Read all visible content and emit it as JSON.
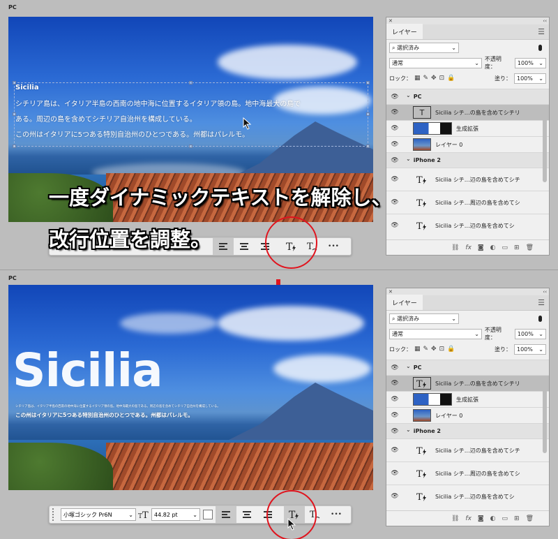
{
  "top": {
    "section_label": "PC",
    "text_title": "Sicilia",
    "text_lines": [
      "シチリア島は、イタリア半島の西南の地中海に位置するイタリア領の島。地中海最大の島で",
      "ある。周辺の島を含めてシチリア自治州を構成している。",
      "この州はイタリアに5つある特別自治州のひとつである。州都はパレルモ。"
    ],
    "caption_line1": "一度ダイナミックテキストを解除し、",
    "caption_line2": "改行位置を調整。",
    "toolbar": {
      "more_label": "•••"
    }
  },
  "bottom": {
    "section_label": "PC",
    "text_title": "Sicilia",
    "small_lines": [
      "シチリア島は、イタリア半島の西南の地中海に位置するイタリア領の島。地中海最大の島である。周辺の島を含めてシチリア自治州を構成している。",
      "この州はイタリアに5つある特別自治州のひとつである。州都はパレルモ。"
    ],
    "toolbar": {
      "font_family": "小塚ゴシック Pr6N",
      "font_size": "44.82 pt",
      "more_label": "•••"
    }
  },
  "panel": {
    "tab_label": "レイヤー",
    "filter_placeholder": "選択済み",
    "blend_mode": "通常",
    "opacity_label": "不透明度：",
    "opacity_value": "100%",
    "lock_label": "ロック：",
    "fill_label": "塗り：",
    "fill_value": "100%",
    "layers": [
      {
        "name": "PC",
        "kind": "group"
      },
      {
        "name": "Sicilia シチ…の島を含めてシチリ",
        "kind": "text",
        "selected": true
      },
      {
        "name": "生成拡張",
        "kind": "adjust"
      },
      {
        "name": "レイヤー 0",
        "kind": "image"
      },
      {
        "name": "iPhone 2",
        "kind": "group"
      },
      {
        "name": "Sicilia シチ…辺の島を含めてシチ",
        "kind": "text"
      },
      {
        "name": "Sicilia シチ…周辺の島を含めてシ",
        "kind": "text"
      },
      {
        "name": "Sicilia シチ…辺の島を含めてシ",
        "kind": "text"
      }
    ]
  },
  "colors": {
    "accent_red": "#e0141e",
    "selection": "#bdbdbd"
  }
}
